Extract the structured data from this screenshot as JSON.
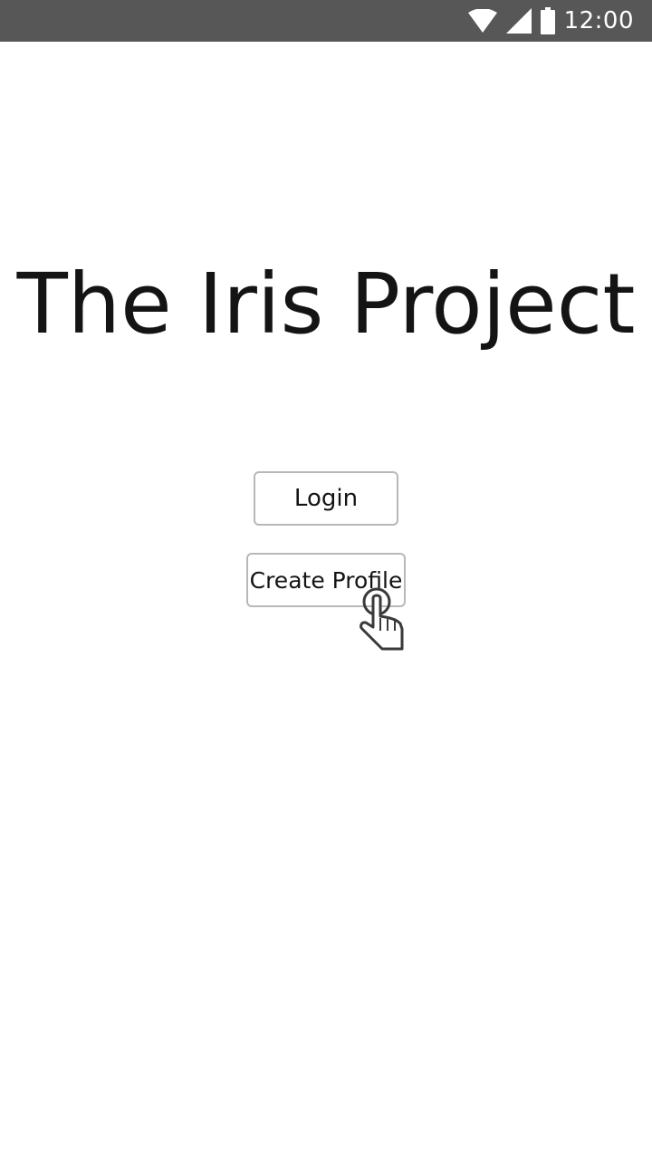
{
  "status_bar": {
    "time": "12:00",
    "icons": [
      "wifi-icon",
      "cell-signal-icon",
      "battery-icon"
    ]
  },
  "screen": {
    "title": "The Iris Project",
    "buttons": {
      "login_label": "Login",
      "create_profile_label": "Create Profile"
    },
    "tap_hint_icon": "hand-pointer-icon"
  },
  "colors": {
    "status_bar_bg": "#575757",
    "background": "#ffffff",
    "text": "#141414",
    "button_border": "#b8b8b8"
  }
}
